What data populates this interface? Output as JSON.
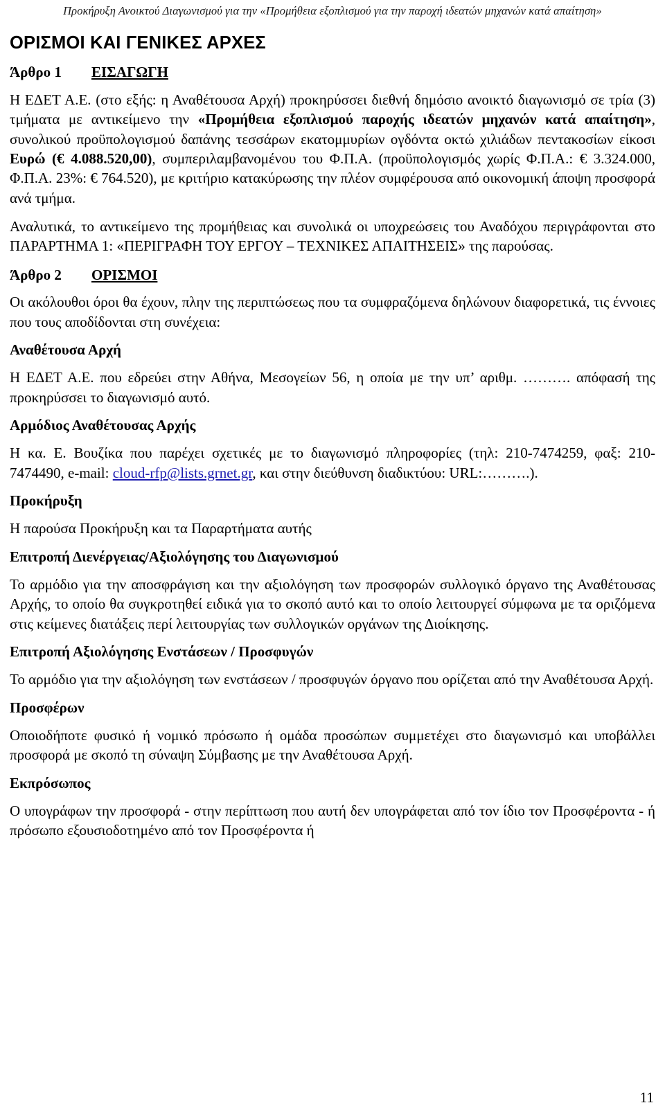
{
  "header": {
    "running_header": "Προκήρυξη Ανοικτού Διαγωνισμού για την «Προμήθεια εξοπλισμού για την παροχή  ιδεατών μηχανών κατά απαίτηση»"
  },
  "document": {
    "title": "ΟΡΙΣΜΟΙ ΚΑΙ ΓΕΝΙΚΕΣ ΑΡΧΕΣ",
    "page_number": "11"
  },
  "articles": [
    {
      "number": "Άρθρο 1",
      "label": "ΕΙΣΑΓΩΓΗ"
    },
    {
      "number": "Άρθρο 2",
      "label": "ΟΡΙΣΜΟΙ"
    }
  ],
  "paragraphs": {
    "intro_p1_part1": "Η ΕΔΕΤ Α.Ε. (στο εξής: η Αναθέτουσα Αρχή) προκηρύσσει διεθνή δημόσιο ανοικτό διαγωνισμό σε τρία (3) τμήματα με αντικείμενο την ",
    "intro_p1_bold1": "«Προμήθεια εξοπλισμού παροχής ιδεατών μηχανών κατά απαίτηση»",
    "intro_p1_part2": ", συνολικού προϋπολογισμού δαπάνης τεσσάρων εκατομμυρίων ογδόντα οκτώ χιλιάδων πεντακοσίων είκοσι ",
    "intro_p1_bold2": "Ευρώ (€ 4.088.520,00)",
    "intro_p1_part3": ", συμπεριλαμβανομένου του Φ.Π.Α. (προϋπολογισμός χωρίς Φ.Π.Α.: € 3.324.000, Φ.Π.Α. 23%: € 764.520), με κριτήριο κατακύρωσης την πλέον συμφέρουσα από οικονομική άποψη προσφορά ανά τμήμα.",
    "intro_p2": "Αναλυτικά, το αντικείμενο της προμήθειας και συνολικά οι υποχρεώσεις του Αναδόχου περιγράφονται στο ΠΑΡΑΡΤΗΜΑ 1: «ΠΕΡΙΓΡΑΦΗ ΤΟΥ ΕΡΓΟΥ – ΤΕΧΝΙΚΕΣ ΑΠΑΙΤΗΣΕΙΣ» της παρούσας.",
    "definitions_intro": "Οι ακόλουθοι όροι θα έχουν, πλην της περιπτώσεως που τα συμφραζόμενα δηλώνουν διαφορετικά, τις έννοιες που τους αποδίδονται στη συνέχεια:"
  },
  "definitions": [
    {
      "term": "Αναθέτουσα Αρχή",
      "body": "Η ΕΔΕΤ Α.Ε. που εδρεύει στην Αθήνα, Μεσογείων 56, η οποία με την υπ’ αριθμ. ………. απόφασή της προκηρύσσει το διαγωνισμό αυτό."
    },
    {
      "term": "Αρμόδιος Αναθέτουσας Αρχής",
      "body_part1": "Η κα. Ε. Βουζίκα που παρέχει σχετικές με το διαγωνισμό πληροφορίες (τηλ: 210-7474259, φαξ: 210-7474490, e-mail: ",
      "body_email": "cloud-rfp@lists.grnet.gr",
      "body_part2": ", και στην διεύθυνση διαδικτύου: URL:……….)."
    },
    {
      "term": "Προκήρυξη",
      "body": "Η παρούσα Προκήρυξη και τα Παραρτήματα αυτής"
    },
    {
      "term": "Επιτροπή Διενέργειας/Αξιολόγησης  του Διαγωνισμού",
      "body": "Το αρμόδιο για την αποσφράγιση και την αξιολόγηση των προσφορών συλλογικό όργανο της Αναθέτουσας Αρχής, το οποίο θα συγκροτηθεί ειδικά για το σκοπό αυτό και το οποίο λειτουργεί σύμφωνα με τα οριζόμενα στις κείμενες διατάξεις περί λειτουργίας των συλλογικών οργάνων της Διοίκησης."
    },
    {
      "term": "Επιτροπή Αξιολόγησης Ενστάσεων / Προσφυγών",
      "body": "Το αρμόδιο για την αξιολόγηση των ενστάσεων / προσφυγών όργανο που ορίζεται από την Αναθέτουσα Αρχή."
    },
    {
      "term": "Προσφέρων",
      "body": "Οποιοδήποτε φυσικό ή νομικό πρόσωπο ή ομάδα προσώπων συμμετέχει στο διαγωνισμό και υποβάλλει προσφορά με σκοπό τη σύναψη Σύμβασης με την Αναθέτουσα Αρχή."
    },
    {
      "term": "Εκπρόσωπος",
      "body": "Ο υπογράφων την προσφορά - στην περίπτωση που αυτή δεν υπογράφεται από τον ίδιο τον Προσφέροντα - ή πρόσωπο εξουσιοδοτημένο από τον Προσφέροντα ή"
    }
  ],
  "colors": {
    "link": "#1a1ab0",
    "text": "#000000",
    "background": "#ffffff"
  }
}
